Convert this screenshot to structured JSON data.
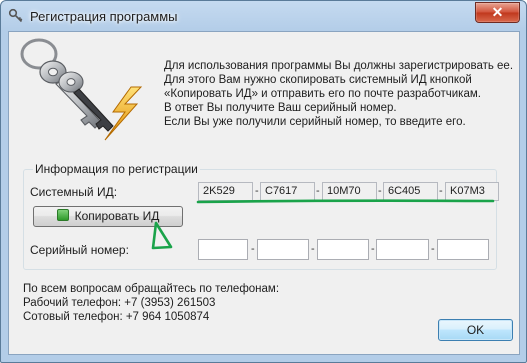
{
  "window": {
    "title": "Регистрация программы",
    "close_label": "✕"
  },
  "intro_text": "Для использования программы Вы должны зарегистрировать ее.\nДля этого Вам нужно скопировать системный ИД кнопкой\n«Копировать ИД» и отправить его по почте разработчикам.\nВ ответ Вы получите Ваш серийный номер.\nЕсли Вы уже получили серийный номер, то введите его.",
  "group": {
    "title": "Информация по регистрации",
    "system_id_label": "Системный ИД:",
    "system_id": [
      "2K529",
      "C7617",
      "10M70",
      "6C405",
      "K07M3"
    ],
    "copy_button": "Копировать ИД",
    "serial_label": "Серийный номер:",
    "serial": [
      "",
      "",
      "",
      "",
      ""
    ],
    "separator": "-"
  },
  "footer_text": "По всем вопросам обращайтесь по телефонам:\nРабочий телефон: +7 (3953) 261503\nСотовый телефон: +7 964 1050874",
  "ok_button": "OK",
  "colors": {
    "annotation": "#1aa34a",
    "titlebar": "#b9d1ea",
    "close": "#c9452a"
  }
}
